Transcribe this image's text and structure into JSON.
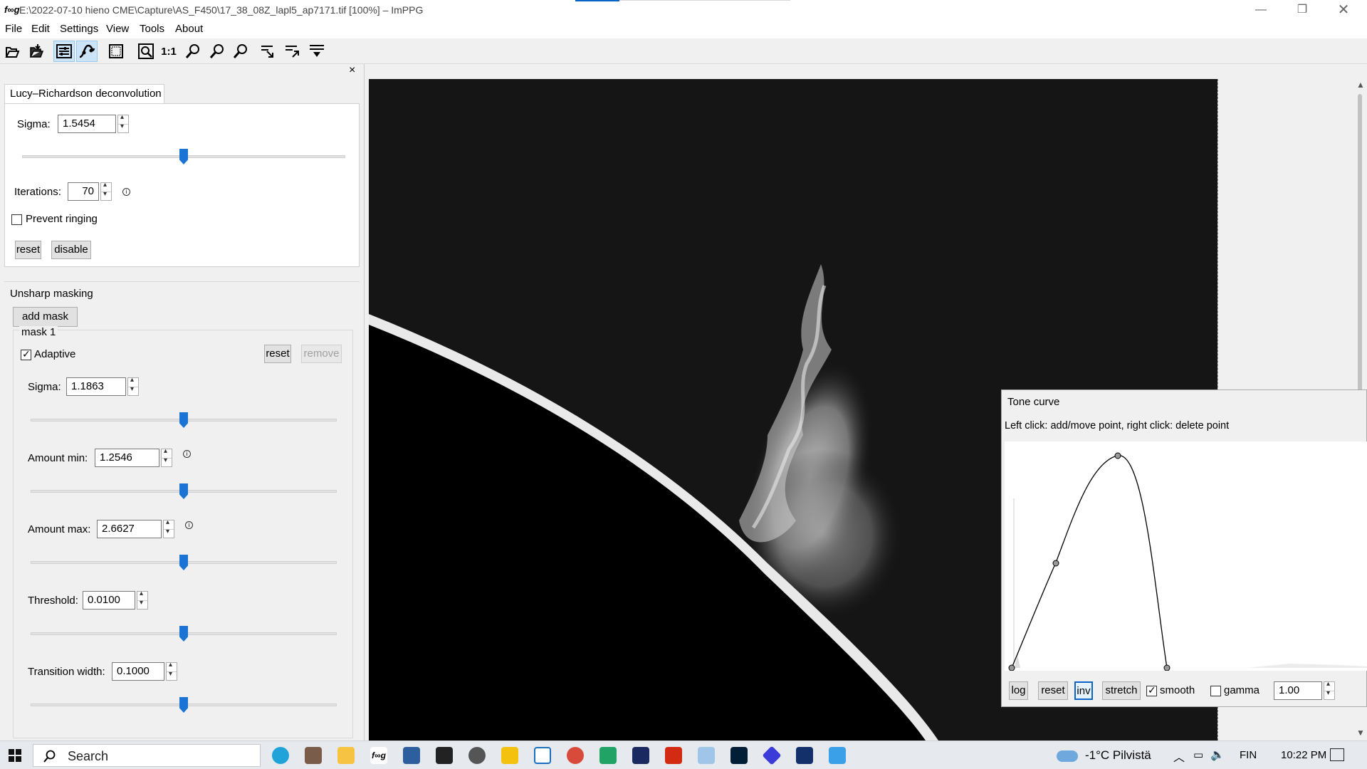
{
  "window": {
    "title": "E:\\2022-07-10 hieno CME\\Capture\\AS_F450\\17_38_08Z_lapl5_ap7171.tif [100%] – ImPPG",
    "app_icon": "f∞g",
    "controls": [
      "minimize-icon",
      "restore-icon",
      "close-icon"
    ]
  },
  "menu": [
    "File",
    "Edit",
    "Settings",
    "View",
    "Tools",
    "About"
  ],
  "toolbar": {
    "one_to_one_label": "1:1",
    "icons": [
      "open-file-icon",
      "save-file-icon",
      "toggle-panel-icon",
      "tone-curve-icon",
      "fit-window-icon",
      "fit-zoom-icon",
      "zoom-in-icon",
      "zoom-out-icon",
      "zoom-custom-icon",
      "align-icon",
      "batch-icon",
      "more-dropdown-icon"
    ]
  },
  "panel": {
    "close_label": "×",
    "lr": {
      "tab_label": "Lucy–Richardson deconvolution",
      "sigma_label": "Sigma:",
      "sigma_value": "1.5454",
      "sigma_slider_frac": 0.5,
      "iterations_label": "Iterations:",
      "iterations_value": "70",
      "prevent_ringing_label": "Prevent ringing",
      "prevent_ringing_checked": false,
      "reset_label": "reset",
      "disable_label": "disable"
    },
    "um": {
      "section_label": "Unsharp masking",
      "add_mask_label": "add mask",
      "mask_title": "mask 1",
      "adaptive_label": "Adaptive",
      "adaptive_checked": true,
      "reset_label": "reset",
      "remove_label": "remove",
      "sigma_label": "Sigma:",
      "sigma_value": "1.1863",
      "amount_min_label": "Amount min:",
      "amount_min_value": "1.2546",
      "amount_max_label": "Amount max:",
      "amount_max_value": "2.6627",
      "threshold_label": "Threshold:",
      "threshold_value": "0.0100",
      "transition_label": "Transition width:",
      "transition_value": "0.1000",
      "slider_fracs": [
        0.5,
        0.5,
        0.5,
        0.5,
        0.5
      ]
    }
  },
  "tone_curve": {
    "title": "Tone curve",
    "hint": "Left click: add/move point, right click: delete point",
    "buttons": {
      "log": "log",
      "reset": "reset",
      "inv": "inv",
      "stretch": "stretch",
      "smooth": "smooth",
      "gamma": "gamma"
    },
    "smooth_checked": true,
    "gamma_checked": false,
    "gamma_value": "1.00"
  },
  "taskbar": {
    "search_placeholder": "Search",
    "weather": "-1°C Pilvistä",
    "language": "FIN",
    "time": "10:22 PM",
    "apps": [
      "edge-icon",
      "app-icon",
      "file-explorer-icon",
      "imppg-icon",
      "app-icon",
      "app-icon",
      "app-icon",
      "fastcopy-icon",
      "window-icon",
      "chrome-icon",
      "spreadsheet-icon",
      "app-icon",
      "app-icon",
      "paint-icon",
      "photoshop-icon",
      "app-icon",
      "app-icon",
      "photos-icon"
    ]
  }
}
